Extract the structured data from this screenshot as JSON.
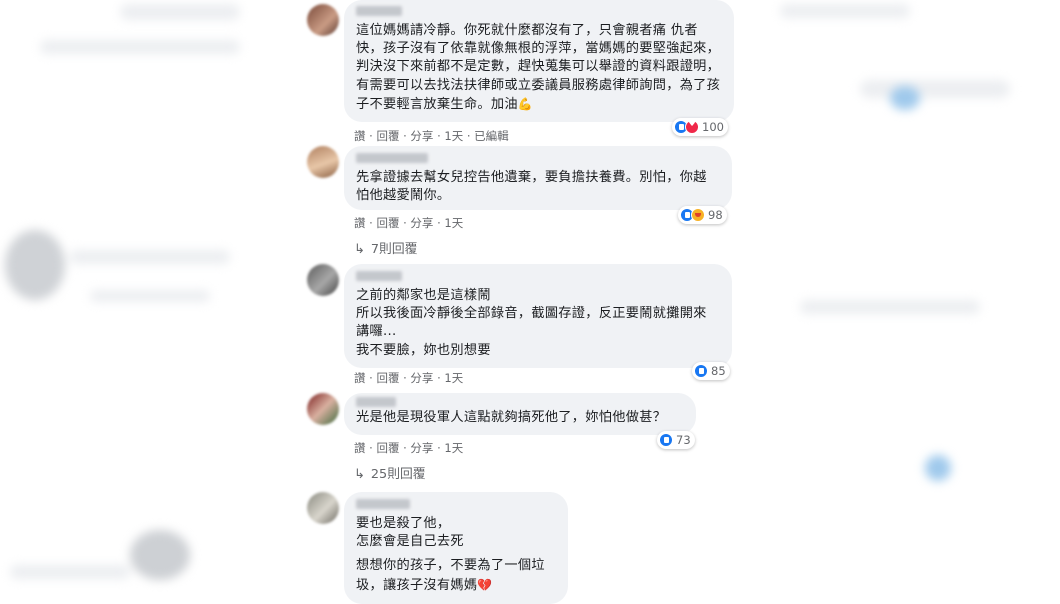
{
  "colors": {
    "bubble": "#f0f2f5",
    "text": "#1c1e21",
    "meta": "#65676b",
    "like": "#1877f2",
    "love": "#f02849"
  },
  "comments": [
    {
      "text": "這位媽媽請冷靜。你死就什麼都沒有了，只會親者痛 仇者快，孩子沒有了依靠就像無根的浮萍，當媽媽的要堅強起來，判決沒下來前都不是定數，趕快蒐集可以舉證的資料跟證明，有需要可以去找法扶律師或立委議員服務處律師詢問，為了孩子不要輕言放棄生命。加油",
      "emoji": "💪",
      "meta": "讚 · 回覆 · 分享 · 1天 · 已編輯",
      "reactions": "100"
    },
    {
      "text": "先拿證據去幫女兒控告他遺棄，要負擔扶養費。別怕，你越怕他越愛鬧你。",
      "meta": "讚 · 回覆 · 分享 · 1天",
      "reactions": "98",
      "replies": "7則回覆"
    },
    {
      "text": "之前的鄰家也是這樣鬧\n所以我後面冷靜後全部錄音，截圖存證，反正要鬧就攤開來講囉...\n我不要臉，妳也別想要",
      "meta": "讚 · 回覆 · 分享 · 1天",
      "reactions": "85"
    },
    {
      "text": "光是他是現役軍人這點就夠搞死他了，妳怕他做甚？",
      "meta": "讚 · 回覆 · 分享 · 1天",
      "reactions": "73",
      "replies": "25則回覆"
    },
    {
      "text": "要也是殺了他，\n怎麼會是自己去死",
      "text2": "想想你的孩子，不要為了一個垃圾，讓孩子沒有媽媽",
      "emoji": "💔"
    }
  ]
}
